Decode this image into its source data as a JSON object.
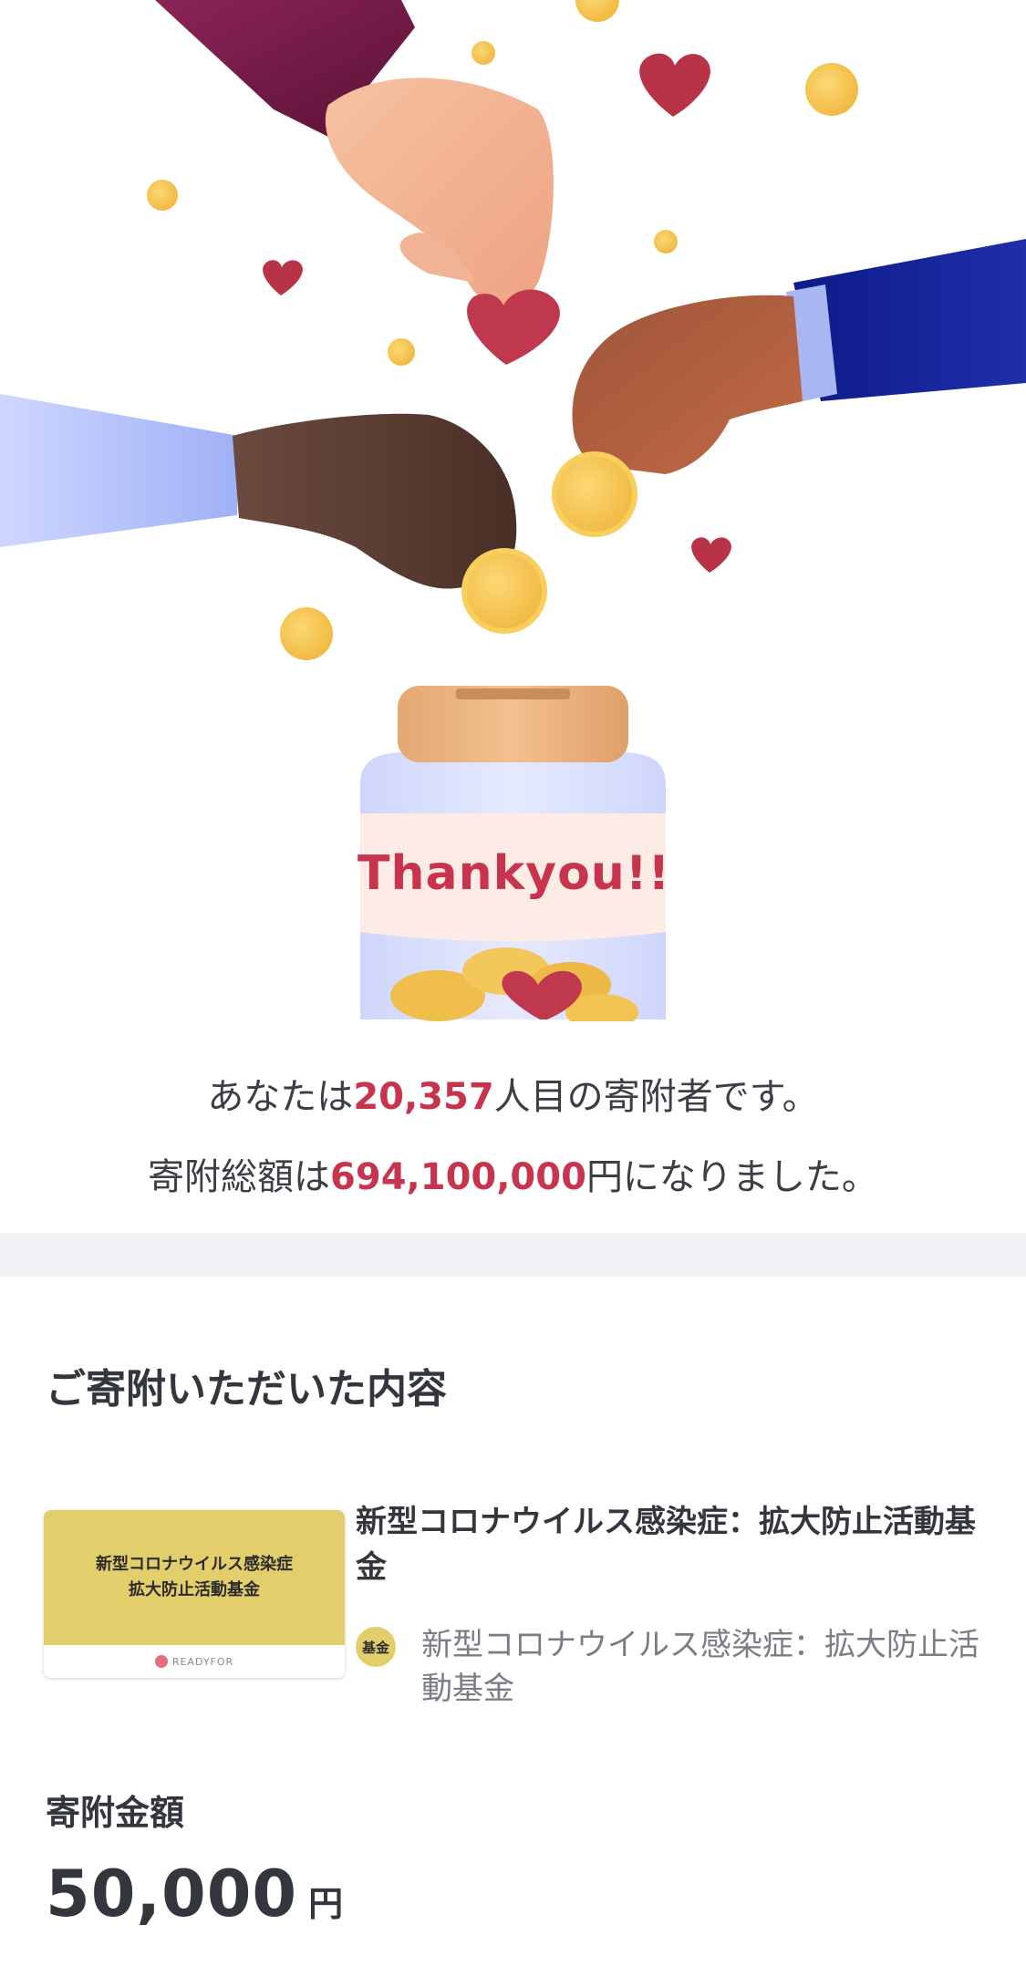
{
  "hero": {
    "jar_label": "Thankyou!!"
  },
  "stats": {
    "donor_prefix": "あなたは",
    "donor_number": "20,357",
    "donor_suffix": "人目の寄附者です。",
    "total_prefix": "寄附総額は",
    "total_amount": "694,100,000",
    "total_suffix": "円になりました。"
  },
  "donation": {
    "section_title": "ご寄附いただいた内容",
    "thumbnail": {
      "line1": "新型コロナウイルス感染症",
      "line2": "拡大防止活動基金",
      "brand": "READYFOR"
    },
    "project_title": "新型コロナウイルス感染症：拡大防止活動基金",
    "org_badge": "基金",
    "org_name": "新型コロナウイルス感染症：拡大防止活動基金"
  },
  "amount": {
    "label": "寄附金額",
    "value": "50,000",
    "unit": "円"
  },
  "colors": {
    "accent": "#c8344d",
    "band": "#f0f1f5",
    "thumbnail_yellow": "#e3ce6c",
    "coin": "#f5c04e",
    "heart": "#b93347"
  }
}
